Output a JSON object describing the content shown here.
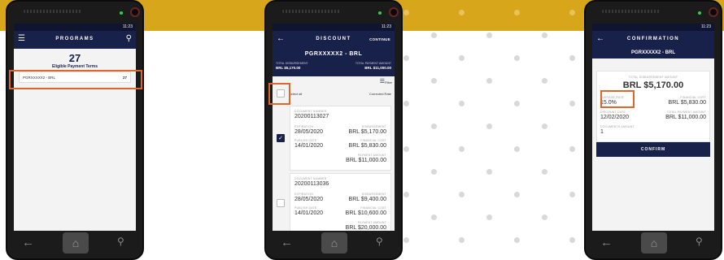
{
  "phone1": {
    "time": "11:23",
    "title": "PROGRAMS",
    "count": "27",
    "subtitle": "Eligible Payment Terms",
    "program": {
      "code": "PGRXXXXX2 - BRL",
      "count": "27"
    }
  },
  "phone2": {
    "time": "11:23",
    "title": "DISCOUNT",
    "continue": "CONTINUE",
    "code": "PGRXXXXX2 - BRL",
    "total_disbursement_label": "TOTAL DISBURSEMENT",
    "total_disbursement": "BRL $5,170.00",
    "total_payment_label": "TOTAL PAYMENT AMOUNT",
    "total_payment": "BRL $11,000.00",
    "filter": "Filter",
    "select_all": "Select all",
    "corrected_rate": "Corrected Rate",
    "documents": [
      {
        "doc_label": "DOCUMENT NUMBER",
        "doc": "20200113027",
        "exp_label": "EXPIRATION",
        "exp": "28/05/2020",
        "disb_label": "DISBURSEMENT",
        "disb": "BRL $5,170.00",
        "pub_label": "PUBLISH DATE",
        "pub": "14/01/2020",
        "fin_label": "FINANCIAL COST",
        "fin": "BRL $5,830.00",
        "pay_label": "PAYMENT AMOUNT",
        "pay": "BRL $11,000.00",
        "checked": true
      },
      {
        "doc_label": "DOCUMENT NUMBER",
        "doc": "20200113036",
        "exp_label": "EXPIRATION",
        "exp": "28/05/2020",
        "disb_label": "DISBURSEMENT",
        "disb": "BRL $9,400.00",
        "pub_label": "PUBLISH DATE",
        "pub": "14/01/2020",
        "fin_label": "FINANCIAL COST",
        "fin": "BRL $10,600.00",
        "pay_label": "PAYMENT AMOUNT",
        "pay": "BRL $20,000.00",
        "checked": false
      }
    ]
  },
  "phone3": {
    "time": "11:23",
    "title": "CONFIRMATION",
    "code": "PGRXXXXX2 - BRL",
    "total_disbursement_label": "TOTAL DISBURSEMENT AMOUNT",
    "total_disbursement": "BRL $5,170.00",
    "avg_rate_label": "AVERAGE RATE",
    "avg_rate": "15.0%",
    "fin_label": "FINANCIAL COST",
    "fin": "BRL $5,830.00",
    "disc_date_label": "DISCOUNT DATE",
    "disc_date": "12/02/2020",
    "total_pay_label": "TOTAL PAYMENT AMOUNT",
    "total_pay": "BRL $11,000.00",
    "docs_label": "DOCUMENTS AMOUNT",
    "docs": "1",
    "confirm": "CONFIRM"
  },
  "colors": {
    "accent": "#e0652a",
    "navy": "#18214a",
    "brand_band": "#d8a61a"
  }
}
